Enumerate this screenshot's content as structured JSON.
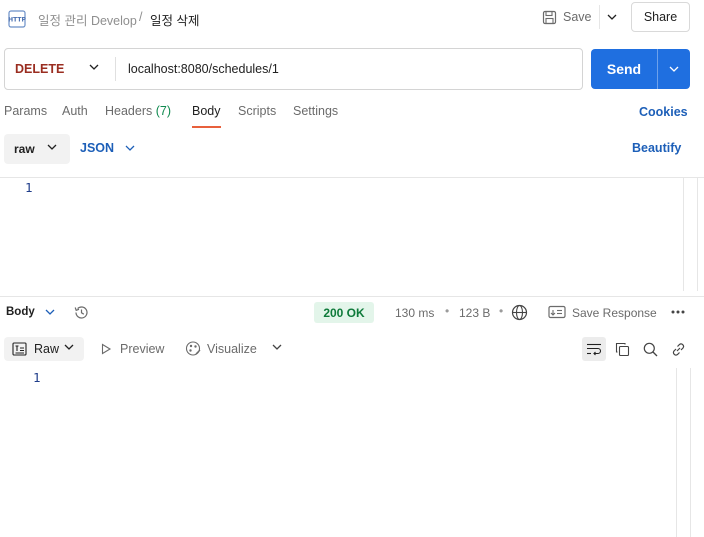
{
  "header": {
    "icon": "http-file-icon",
    "breadcrumb_parent": "일정 관리 Develop",
    "breadcrumb_separator": "/",
    "breadcrumb_current": "일정 삭제",
    "save_label": "Save",
    "share_label": "Share"
  },
  "request": {
    "method": "DELETE",
    "method_color": "#9a2d20",
    "url": "localhost:8080/schedules/1",
    "send_label": "Send",
    "send_color": "#1f6fe0"
  },
  "tabs": {
    "items": [
      {
        "label": "Params"
      },
      {
        "label": "Auth"
      },
      {
        "label": "Headers",
        "count": "(7)"
      },
      {
        "label": "Body"
      },
      {
        "label": "Scripts"
      },
      {
        "label": "Settings"
      }
    ],
    "active": "Body",
    "cookies_label": "Cookies"
  },
  "body_options": {
    "mode": "raw",
    "language": "JSON",
    "beautify_label": "Beautify"
  },
  "request_editor": {
    "line_numbers": [
      "1"
    ]
  },
  "response": {
    "section_label": "Body",
    "status": "200 OK",
    "status_color": "#0e7a3a",
    "time": "130 ms",
    "size": "123 B",
    "separator": "•",
    "save_response_label": "Save Response",
    "views": {
      "selected": "Raw",
      "preview": "Preview",
      "visualize": "Visualize"
    },
    "line_numbers": [
      "1"
    ]
  }
}
